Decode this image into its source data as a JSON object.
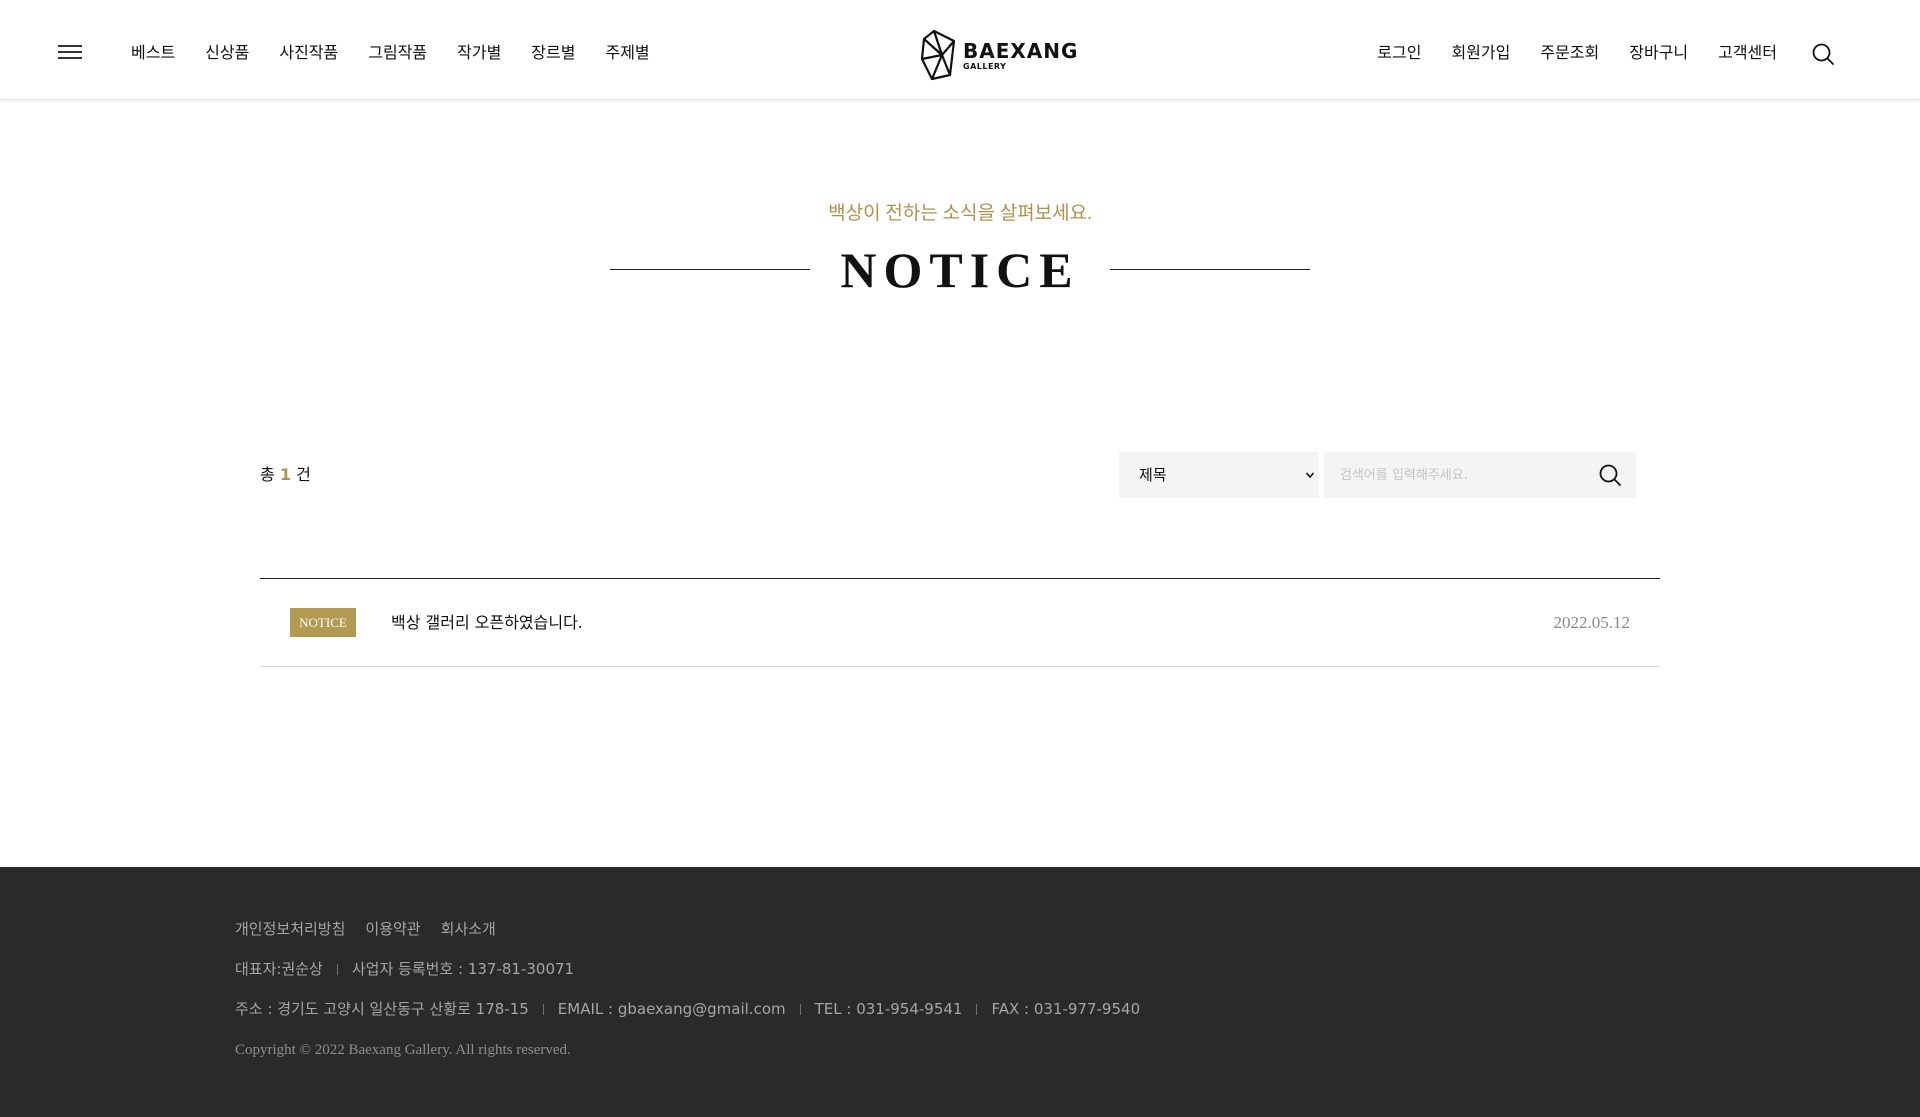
{
  "header": {
    "nav_left": [
      "베스트",
      "신상품",
      "사진작품",
      "그림작품",
      "작가별",
      "장르별",
      "주제별"
    ],
    "logo": {
      "name": "BAEXANG",
      "sub": "GALLERY"
    },
    "nav_right": [
      "로그인",
      "회원가입",
      "주문조회",
      "장바구니",
      "고객센터"
    ]
  },
  "page": {
    "subtitle": "백상이 전하는 소식을 살펴보세요.",
    "title": "NOTICE"
  },
  "toolbar": {
    "total_prefix": "총",
    "total_count": "1",
    "total_suffix": "건",
    "select_value": "제목",
    "search_placeholder": "검색어를 입력해주세요."
  },
  "notices": [
    {
      "badge": "NOTICE",
      "title": "백상 갤러리 오픈하였습니다.",
      "date": "2022.05.12"
    }
  ],
  "footer": {
    "links": [
      "개인정보처리방침",
      "이용약관",
      "회사소개"
    ],
    "line1": [
      "대표자:권순상",
      "사업자 등록번호 : 137-81-30071"
    ],
    "line2": [
      "주소 : 경기도 고양시 일산동구 산황로 178-15",
      "EMAIL : gbaexang@gmail.com",
      "TEL : 031-954-9541",
      "FAX : 031-977-9540"
    ],
    "copyright": "Copyright © 2022 Baexang Gallery. All rights reserved."
  },
  "colors": {
    "accent": "#b0924d",
    "badge": "#b39a52",
    "footer_bg": "#2a2a2a"
  }
}
